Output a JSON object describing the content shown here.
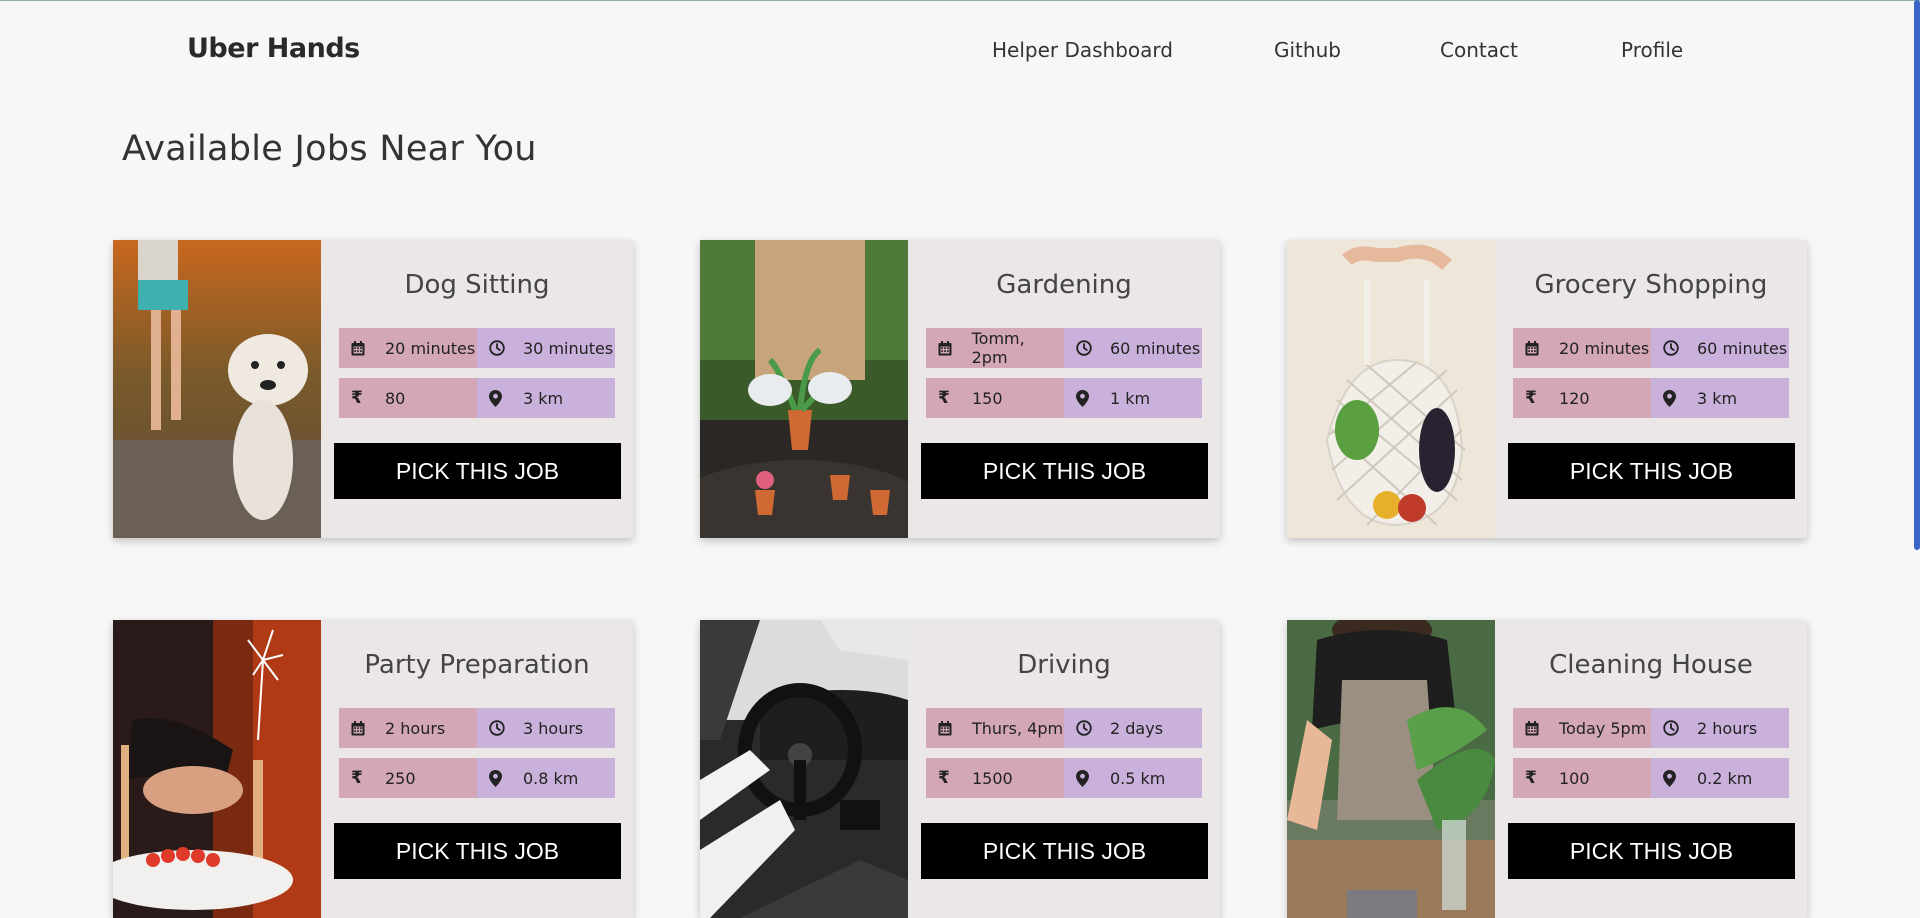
{
  "brand": "Uber Hands",
  "nav": [
    {
      "label": "Helper Dashboard"
    },
    {
      "label": "Github"
    },
    {
      "label": "Contact"
    },
    {
      "label": "Profile"
    }
  ],
  "page_title": "Available Jobs Near You",
  "pick_label": "PICK THIS JOB",
  "colors": {
    "pink_chip": "#d3a7b5",
    "lavender_chip": "#c9b1dc",
    "card_bg": "#ebe7e6",
    "button_bg": "#000000",
    "scrollbar": "#3a66c8"
  },
  "jobs": [
    {
      "title": "Dog Sitting",
      "date": "20 minutes",
      "duration": "30 minutes",
      "price": "80",
      "distance": "3 km",
      "image": "dog-walking-photo"
    },
    {
      "title": "Gardening",
      "date": "Tomm, 2pm",
      "duration": "60 minutes",
      "price": "150",
      "distance": "1 km",
      "image": "potted-plants-photo"
    },
    {
      "title": "Grocery Shopping",
      "date": "20 minutes",
      "duration": "60 minutes",
      "price": "120",
      "distance": "3 km",
      "image": "grocery-net-bag-photo"
    },
    {
      "title": "Party Preparation",
      "date": "2 hours",
      "duration": "3 hours",
      "price": "250",
      "distance": "0.8 km",
      "image": "birthday-cake-sparkler-photo"
    },
    {
      "title": "Driving",
      "date": "Thurs, 4pm",
      "duration": "2 days",
      "price": "1500",
      "distance": "0.5 km",
      "image": "car-steering-wheel-photo"
    },
    {
      "title": "Cleaning House",
      "date": "Today 5pm",
      "duration": "2 hours",
      "price": "100",
      "distance": "0.2 km",
      "image": "cleaning-table-photo"
    }
  ]
}
